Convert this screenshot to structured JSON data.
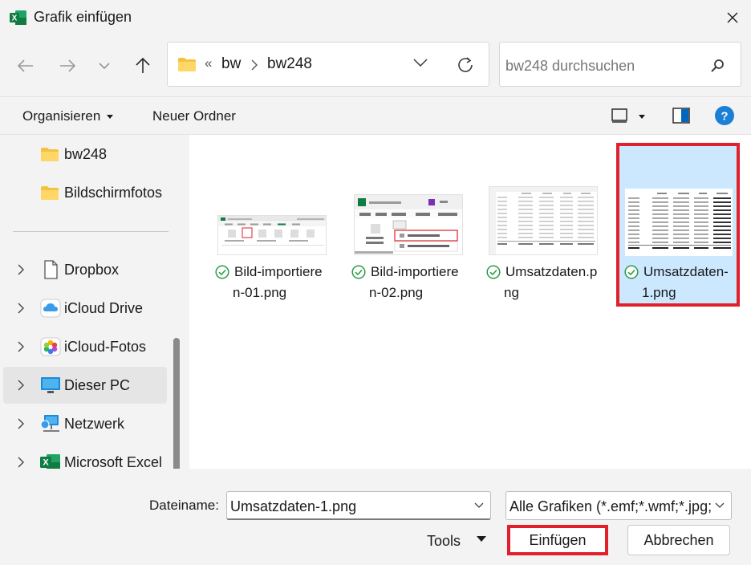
{
  "window": {
    "title": "Grafik einfügen"
  },
  "address": {
    "parent": "bw",
    "current": "bw248",
    "overflow": "«"
  },
  "search": {
    "placeholder": "bw248 durchsuchen"
  },
  "commands": {
    "organize": "Organisieren",
    "new_folder": "Neuer Ordner"
  },
  "sidebar": {
    "items": [
      {
        "label": "bw248",
        "icon": "folder-icon"
      },
      {
        "label": "Bildschirmfotos",
        "icon": "folder-icon"
      },
      {
        "label": "Dropbox",
        "icon": "document-icon"
      },
      {
        "label": "iCloud Drive",
        "icon": "icloud-icon"
      },
      {
        "label": "iCloud-Fotos",
        "icon": "photos-icon"
      },
      {
        "label": "Dieser PC",
        "icon": "pc-icon"
      },
      {
        "label": "Netzwerk",
        "icon": "network-icon"
      },
      {
        "label": "Microsoft Excel",
        "icon": "excel-icon"
      }
    ]
  },
  "files": [
    {
      "line1": "Bild-importiere",
      "line2": "n-01.png"
    },
    {
      "line1": "Bild-importiere",
      "line2": "n-02.png"
    },
    {
      "line1": "Umsatzdaten.p",
      "line2": "ng"
    },
    {
      "line1": "Umsatzdaten-",
      "line2": "1.png"
    }
  ],
  "footer": {
    "filename_label": "Dateiname:",
    "filename_value": "Umsatzdaten-1.png",
    "filter_value": "Alle Grafiken (*.emf;*.wmf;*.jpg;",
    "tools": "Tools",
    "insert": "Einfügen",
    "cancel": "Abbrechen"
  },
  "colors": {
    "accent": "#0067c0",
    "selection": "#cce8ff",
    "highlight": "#e0202a",
    "excel": "#107c41",
    "folder": "#f3c240"
  }
}
